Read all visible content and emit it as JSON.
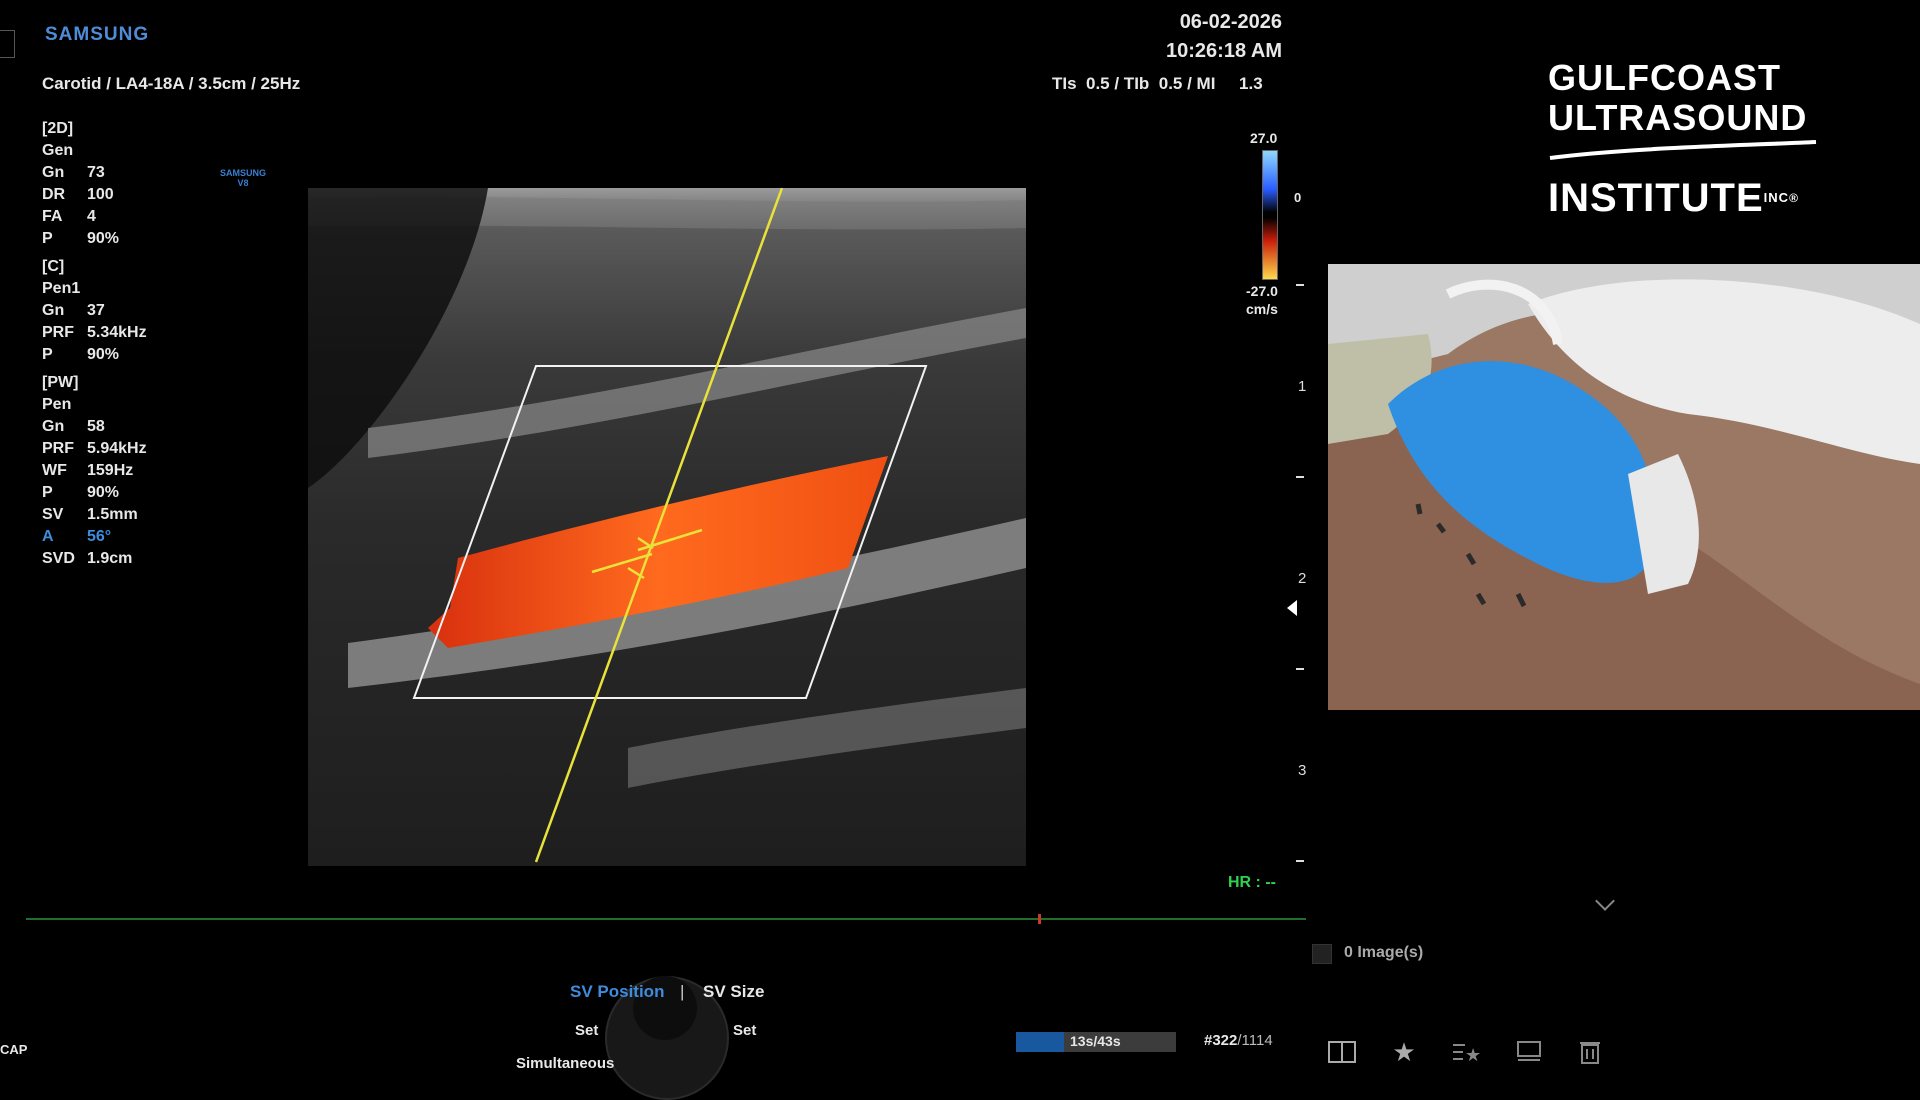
{
  "header": {
    "brand": "SAMSUNG",
    "exam": "Carotid / LA4-18A / 3.5cm / 25Hz",
    "date": "06-02-2026",
    "time": "10:26:18 AM",
    "tis_label": "TIs  0.5 / TIb  0.5 / MI     1.3"
  },
  "params": {
    "sec_2d": "[2D]",
    "mode_2d": "Gen",
    "rows_2d": [
      {
        "k": "Gn",
        "v": "73"
      },
      {
        "k": "DR",
        "v": "100"
      },
      {
        "k": "FA",
        "v": "4"
      },
      {
        "k": "P",
        "v": "90%"
      }
    ],
    "sec_c": "[C]",
    "mode_c": "Pen1",
    "rows_c": [
      {
        "k": "Gn",
        "v": "37"
      },
      {
        "k": "PRF",
        "v": "5.34kHz"
      },
      {
        "k": "P",
        "v": "90%"
      }
    ],
    "sec_pw": "[PW]",
    "mode_pw": "Pen",
    "rows_pw": [
      {
        "k": "Gn",
        "v": "58"
      },
      {
        "k": "PRF",
        "v": "5.94kHz"
      },
      {
        "k": "WF",
        "v": "159Hz"
      },
      {
        "k": "P",
        "v": "90%"
      },
      {
        "k": "SV",
        "v": "1.5mm"
      },
      {
        "k": "A",
        "v": "56°"
      },
      {
        "k": "SVD",
        "v": "1.9cm"
      }
    ]
  },
  "mini_brand": {
    "l1": "SAMSUNG",
    "l2": "V8"
  },
  "color_scale": {
    "max": "27.0",
    "min": "-27.0",
    "unit": "cm/s",
    "zero": "0"
  },
  "depth_labels": [
    "1",
    "2",
    "3"
  ],
  "hr": "HR : --",
  "controls": {
    "sv_position": "SV Position",
    "separator": "|",
    "sv_size": "SV Size",
    "set_left": "Set",
    "set_right": "Set",
    "simultaneous": "Simultaneous",
    "cap": "CAP"
  },
  "cine": {
    "progress": "13s/43s",
    "fraction": 0.302,
    "frame": "#322",
    "total": "/1114"
  },
  "logo": {
    "line1": "GULFCOAST",
    "line2": "ULTRASOUND",
    "line3": "INSTITUTE",
    "suffix": "INC",
    "reg": "®"
  },
  "images": {
    "count": "0 Image(s)"
  },
  "toolbar": {
    "icons": [
      "split-view-icon",
      "star-icon",
      "star-list-icon",
      "dicom-icon",
      "trash-icon"
    ]
  },
  "colors": {
    "accent": "#3f8bdc",
    "hr": "#2fd24f",
    "doppler_line": "#e8e23a",
    "flow": "#f05a1a"
  }
}
